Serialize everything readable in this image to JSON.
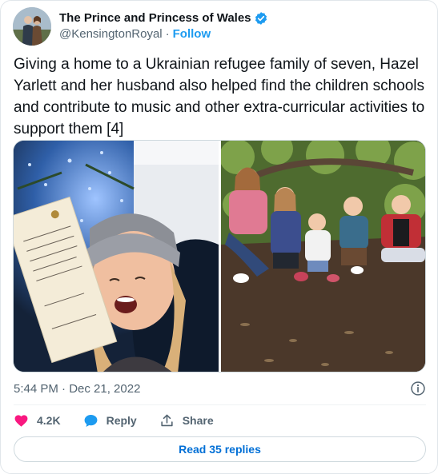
{
  "account": {
    "display_name": "The Prince and Princess of Wales",
    "handle": "@KensingtonRoyal",
    "separator": "·",
    "follow_label": "Follow",
    "verified_icon": "verified-badge-icon"
  },
  "tweet": {
    "text": "Giving a home to a Ukrainian refugee family of seven, Hazel Yarlett and her husband also helped find the children schools and contribute to music and other extra-curricular activities to support them [4]",
    "timestamp": "5:44 PM · Dec 21, 2022"
  },
  "media": {
    "photo_left_alt": "Woman holding a royal card in front of a lit Christmas tree",
    "photo_right_alt": "Five children sitting on the ground in a garden"
  },
  "actions": {
    "like_count": "4.2K",
    "reply_label": "Reply",
    "share_label": "Share"
  },
  "replies_button": "Read 35 replies",
  "colors": {
    "accent": "#1d9bf0",
    "like": "#f91880",
    "link": "#006fd6",
    "text_secondary": "#536471"
  }
}
